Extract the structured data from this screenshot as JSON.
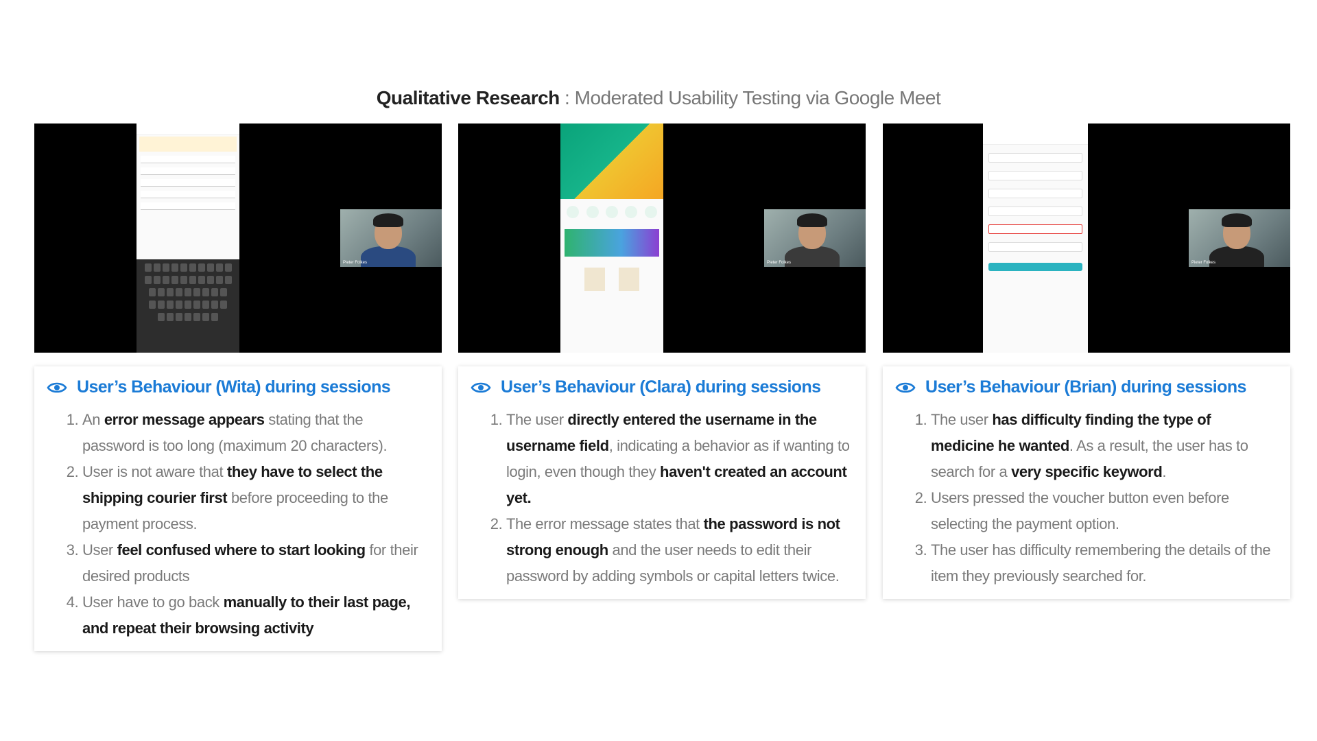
{
  "title": {
    "bold": "Qualitative Research",
    "rest": " : Moderated Usability Testing via Google Meet"
  },
  "cards": [
    {
      "heading": "User’s Behaviour (Wita) during sessions",
      "participant_label": "Pieter Folkes",
      "items": [
        [
          {
            "t": "An ",
            "b": false
          },
          {
            "t": "error message appears",
            "b": true
          },
          {
            "t": " stating that the password is too long (maximum 20 characters).",
            "b": false
          }
        ],
        [
          {
            "t": "User is not aware that ",
            "b": false
          },
          {
            "t": "they have to select the shipping courier first",
            "b": true
          },
          {
            "t": " before proceeding to the payment process.",
            "b": false
          }
        ],
        [
          {
            "t": "User ",
            "b": false
          },
          {
            "t": "feel confused where to start looking",
            "b": true
          },
          {
            "t": " for their desired products",
            "b": false
          }
        ],
        [
          {
            "t": "User have to go back ",
            "b": false
          },
          {
            "t": "manually to their last page, and repeat their browsing activity",
            "b": true
          }
        ]
      ]
    },
    {
      "heading": "User’s Behaviour (Clara) during sessions",
      "participant_label": "Pieter Folkes",
      "items": [
        [
          {
            "t": "The user ",
            "b": false
          },
          {
            "t": "directly entered the username in the username field",
            "b": true
          },
          {
            "t": ", indicating a behavior as if wanting to login, even though they ",
            "b": false
          },
          {
            "t": "haven't created an account yet.",
            "b": true
          }
        ],
        [
          {
            "t": "The error message states that ",
            "b": false
          },
          {
            "t": "the password is not strong enough",
            "b": true
          },
          {
            "t": " and the user needs to edit their password by adding symbols or capital letters twice.",
            "b": false
          }
        ]
      ]
    },
    {
      "heading": "User’s Behaviour (Brian) during sessions",
      "participant_label": "Pieter Folkes",
      "items": [
        [
          {
            "t": "The user ",
            "b": false
          },
          {
            "t": "has difficulty finding the type of medicine he wanted",
            "b": true
          },
          {
            "t": ". As a result, the user has to search for a ",
            "b": false
          },
          {
            "t": "very specific keyword",
            "b": true
          },
          {
            "t": ".",
            "b": false
          }
        ],
        [
          {
            "t": "Users pressed the voucher button even before selecting the payment option.",
            "b": false
          }
        ],
        [
          {
            "t": "The user has difficulty remembering the details of the item they previously searched for.",
            "b": false
          }
        ]
      ]
    }
  ]
}
